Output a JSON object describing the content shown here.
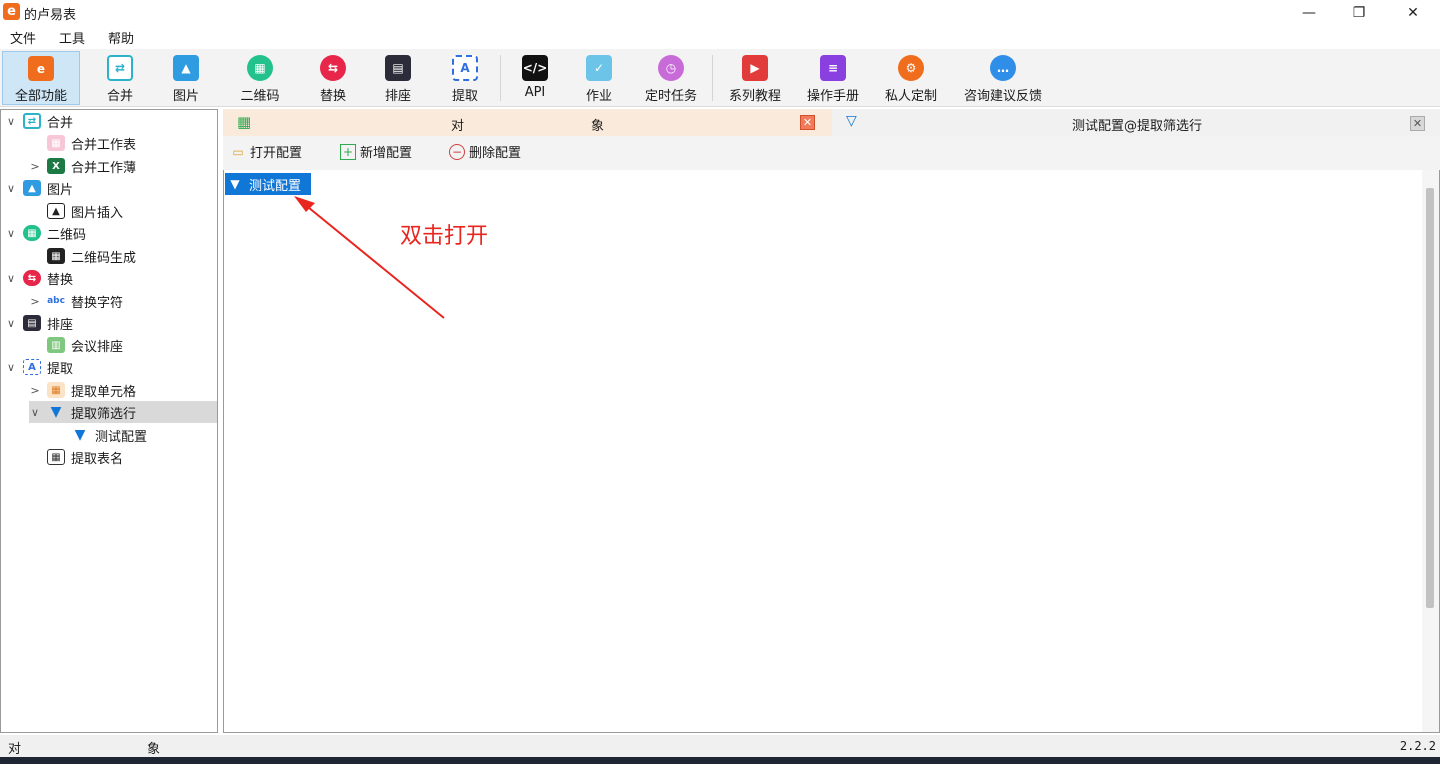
{
  "window": {
    "title": "的卢易表",
    "logo_letter": "e",
    "minimize": "—",
    "maximize": "❐",
    "close": "✕"
  },
  "menu": [
    "文件",
    "工具",
    "帮助"
  ],
  "toolbar": [
    {
      "label": "全部功能",
      "icon": "all-functions-icon",
      "active": true
    },
    {
      "label": "合并",
      "icon": "merge-icon"
    },
    {
      "label": "图片",
      "icon": "image-icon"
    },
    {
      "label": "二维码",
      "icon": "qrcode-icon"
    },
    {
      "label": "替换",
      "icon": "replace-icon"
    },
    {
      "label": "排座",
      "icon": "seating-icon"
    },
    {
      "label": "提取",
      "icon": "extract-icon"
    },
    {
      "label": "API",
      "icon": "api-icon"
    },
    {
      "label": "作业",
      "icon": "job-icon"
    },
    {
      "label": "定时任务",
      "icon": "timer-icon"
    },
    {
      "label": "系列教程",
      "icon": "tutorial-icon"
    },
    {
      "label": "操作手册",
      "icon": "manual-icon"
    },
    {
      "label": "私人定制",
      "icon": "custom-icon"
    },
    {
      "label": "咨询建议反馈",
      "icon": "feedback-icon"
    }
  ],
  "tree": [
    {
      "label": "合并",
      "level": 0,
      "expander": "∨"
    },
    {
      "label": "合并工作表",
      "level": 1,
      "expander": ""
    },
    {
      "label": "合并工作薄",
      "level": 1,
      "expander": ">"
    },
    {
      "label": "图片",
      "level": 0,
      "expander": "∨"
    },
    {
      "label": "图片插入",
      "level": 1,
      "expander": ""
    },
    {
      "label": "二维码",
      "level": 0,
      "expander": "∨"
    },
    {
      "label": "二维码生成",
      "level": 1,
      "expander": ""
    },
    {
      "label": "替换",
      "level": 0,
      "expander": "∨"
    },
    {
      "label": "替换字符",
      "level": 1,
      "expander": ">"
    },
    {
      "label": "排座",
      "level": 0,
      "expander": "∨"
    },
    {
      "label": "会议排座",
      "level": 1,
      "expander": ""
    },
    {
      "label": "提取",
      "level": 0,
      "expander": "∨"
    },
    {
      "label": "提取单元格",
      "level": 1,
      "expander": ">"
    },
    {
      "label": "提取筛选行",
      "level": 1,
      "expander": "∨",
      "selected": true
    },
    {
      "label": "测试配置",
      "level": 2,
      "expander": ""
    },
    {
      "label": "提取表名",
      "level": 1,
      "expander": ""
    }
  ],
  "tabs": {
    "left_char1": "对",
    "left_char2": "象",
    "right_title": "测试配置@提取筛选行",
    "close_glyph": "✕"
  },
  "actions": {
    "open": "打开配置",
    "add": "新增配置",
    "delete": "删除配置"
  },
  "content": {
    "config_item": "测试配置",
    "annotation": "双击打开"
  },
  "status": {
    "char1": "对",
    "char2": "象",
    "version": "2.2.2"
  },
  "colors": {
    "accent": "#1077d6",
    "annotation": "#e8251e",
    "tab_left_bg": "#faeadb",
    "logo": "#f06d1e"
  }
}
